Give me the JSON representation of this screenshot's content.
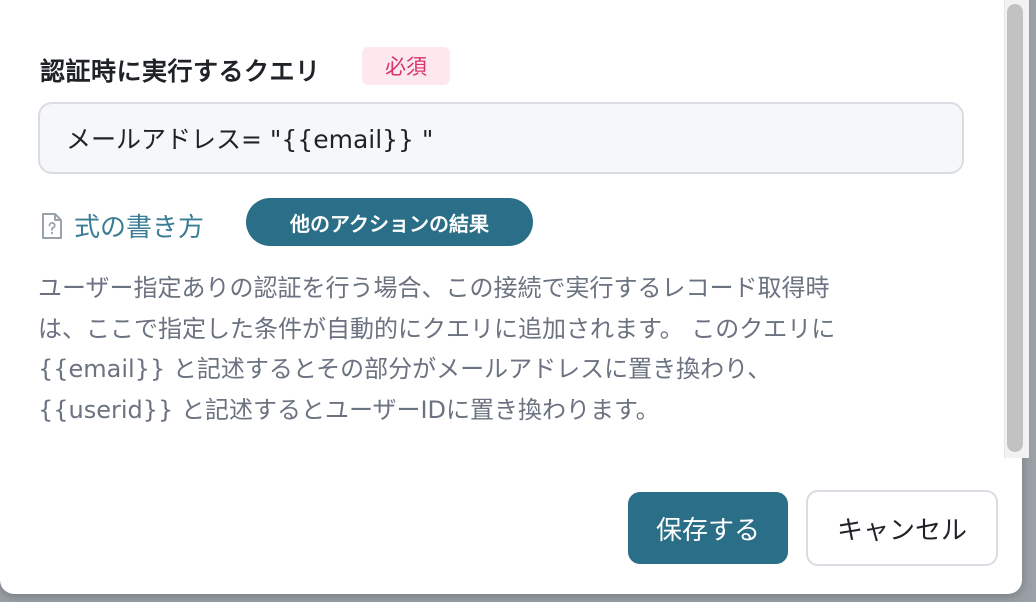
{
  "field": {
    "label": "認証時に実行するクエリ",
    "required_badge": "必須",
    "query_value": "メールアドレス= \"{{email}} \""
  },
  "help": {
    "link_label": "式の書き方",
    "icon": "document-help-icon",
    "action_button": "他のアクションの結果"
  },
  "description": {
    "lines": [
      "ユーザー指定ありの認証を行う場合、この接続で実行するレコード取得時",
      "は、ここで指定した条件が自動的にクエリに追加されます。 このクエリに",
      "{{email}} と記述するとその部分がメールアドレスに置き換わり、",
      "{{userid}} と記述するとユーザーIDに置き換わります。"
    ]
  },
  "footer": {
    "save_label": "保存する",
    "cancel_label": "キャンセル"
  },
  "colors": {
    "accent": "#2a6f87",
    "link": "#3a7d94",
    "required_text": "#d6336c",
    "required_bg": "#fde8ee"
  }
}
